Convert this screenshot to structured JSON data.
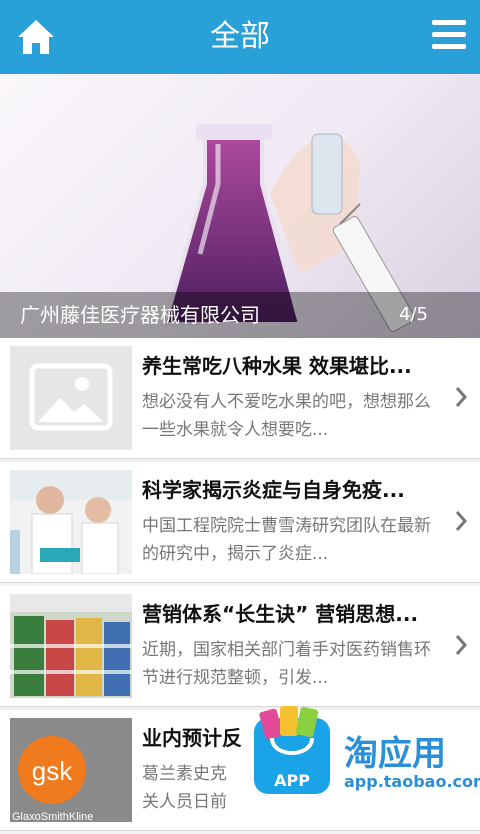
{
  "header": {
    "title": "全部",
    "home_icon": "home-icon",
    "menu_icon": "menu-icon"
  },
  "banner": {
    "caption": "广州藤佳医疗器械有限公司",
    "counter": "4/5"
  },
  "articles": [
    {
      "title": "养生常吃八种水果 效果堪比...",
      "desc": "想必没有人不爱吃水果的吧，想想那么一些水果就令人想要吃...",
      "thumb": "placeholder-image"
    },
    {
      "title": "科学家揭示炎症与自身免疫...",
      "desc": "中国工程院院士曹雪涛研究团队在最新的研究中，揭示了炎症...",
      "thumb": "lab-photo"
    },
    {
      "title": "营销体系“长生诀” 营销思想...",
      "desc": "近期，国家相关部门着手对医药销售环节进行规范整顿，引发...",
      "thumb": "pharmacy-shelves-photo"
    },
    {
      "title": "业内预计反",
      "desc": "葛兰素史克",
      "desc2": "关人员日前",
      "thumb": "gsk-logo-photo",
      "logo_text": "gsk",
      "logo_sub": "GlaxoSmithKline"
    }
  ],
  "overlay_badge": {
    "brand": "淘应用",
    "site": "app.taobao.com",
    "bag_label": "APP"
  },
  "colors": {
    "header": "#2aa0d8",
    "accent": "#2a8fd9"
  }
}
